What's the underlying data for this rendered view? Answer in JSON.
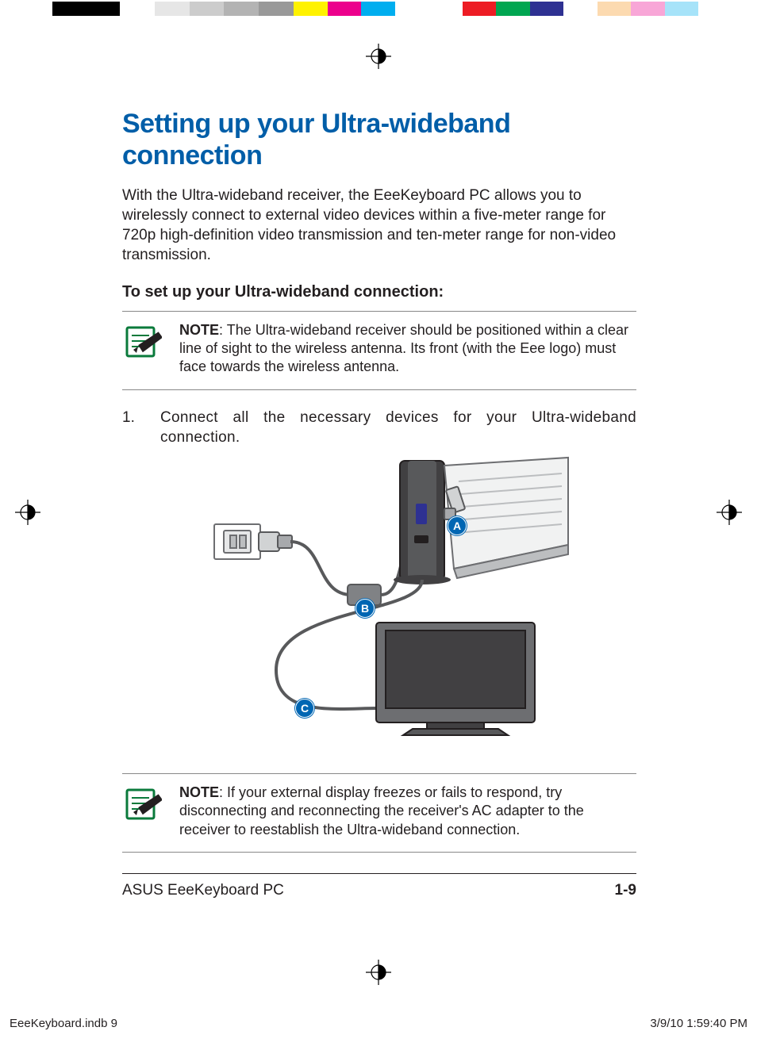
{
  "colorbar": {
    "grays": [
      "#ffffff",
      "#e6e6e6",
      "#cccccc",
      "#b3b3b3",
      "#999999"
    ],
    "hues": [
      "#fff200",
      "#ec008c",
      "#00aeef",
      "#ed1c24",
      "#00a651",
      "#2e3192",
      "#fff",
      "#00a99d",
      "#f7941d",
      "#92278f"
    ]
  },
  "title": "Setting up your Ultra-wideband connection",
  "intro": "With the Ultra-wideband receiver, the EeeKeyboard PC allows you to wirelessly connect to external video devices within a five-meter range for 720p high-definition video transmission and ten-meter range for non-video transmission.",
  "subhead": "To set up your Ultra-wideband connection:",
  "note1_label": "NOTE",
  "note1_text": ": The Ultra-wideband receiver should be positioned within a clear line of sight to the wireless antenna. Its  front (with the Eee logo) must face towards the wireless antenna.",
  "step1_num": "1.",
  "step1_text": "Connect all the necessary devices for your Ultra-wideband connection.",
  "callouts": {
    "a": "A",
    "b": "B",
    "c": "C"
  },
  "note2_label": "NOTE",
  "note2_text": ": If your external display freezes or fails to respond, try disconnecting and reconnecting the receiver's AC adapter to the receiver to reestablish the Ultra-wideband connection.",
  "footer_left": "ASUS EeeKeyboard PC",
  "footer_page": "1-9",
  "slug_file": "EeeKeyboard.indb   9",
  "slug_time": "3/9/10   1:59:40 PM"
}
